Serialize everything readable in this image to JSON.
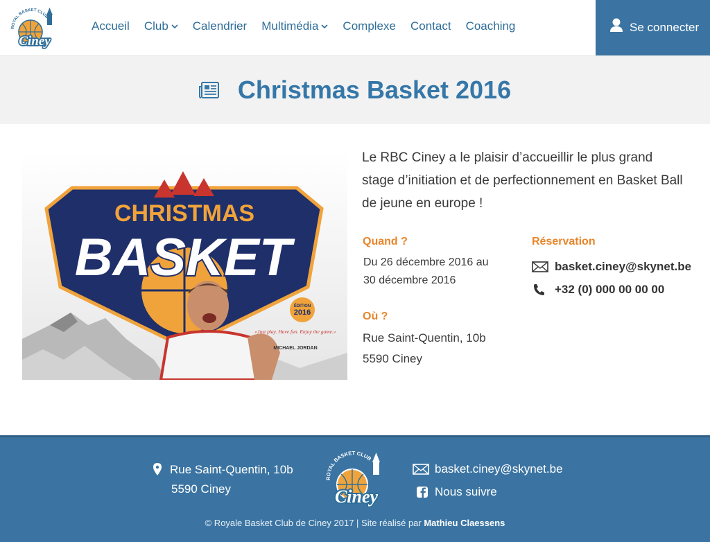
{
  "nav": {
    "logo_top": "ROYAL BASKET CLUB",
    "logo_name": "Ciney",
    "items": [
      {
        "label": "Accueil",
        "dropdown": false
      },
      {
        "label": "Club",
        "dropdown": true
      },
      {
        "label": "Calendrier",
        "dropdown": false
      },
      {
        "label": "Multimédia",
        "dropdown": true
      },
      {
        "label": "Complexe",
        "dropdown": false
      },
      {
        "label": "Contact",
        "dropdown": false
      },
      {
        "label": "Coaching",
        "dropdown": false
      }
    ],
    "login_label": "Se connecter"
  },
  "page": {
    "title": "Christmas Basket 2016"
  },
  "poster": {
    "line1": "CHRISTMAS",
    "line2": "BASKET",
    "badge_top": "ÉDITION",
    "badge_year": "2016",
    "quote": "«Just play. Have fun. Enjoy the game.»",
    "quote_author": "MICHAEL JORDAN"
  },
  "event": {
    "intro": "Le RBC Ciney a le plaisir d’accueillir le plus grand stage d’initiation et de perfectionnement en Basket Ball de jeune en europe !",
    "when_label": "Quand ?",
    "when_text": "Du 26 décembre 2016 au 30 décembre 2016",
    "where_label": "Où ?",
    "where_line1": "Rue Saint-Quentin, 10b",
    "where_line2": "5590 Ciney",
    "reservation_label": "Réservation",
    "reservation_email": "basket.ciney@skynet.be",
    "reservation_phone": "+32 (0) 000 00 00 00"
  },
  "footer": {
    "address_line1": "Rue Saint-Quentin, 10b",
    "address_line2": "5590 Ciney",
    "email": "basket.ciney@skynet.be",
    "follow": "Nous suivre",
    "copyright": "© Royale Basket Club de Ciney 2017  |  Site réalisé par ",
    "author": "Mathieu Claessens"
  },
  "colors": {
    "brand_blue": "#3b74a2",
    "title_blue": "#3577a8",
    "accent_orange": "#e8852b",
    "nav_text": "#2f6e99"
  },
  "icons": [
    "user-icon",
    "newspaper-icon",
    "envelope-icon",
    "phone-icon",
    "map-pin-icon",
    "facebook-icon",
    "chevron-down-icon"
  ]
}
